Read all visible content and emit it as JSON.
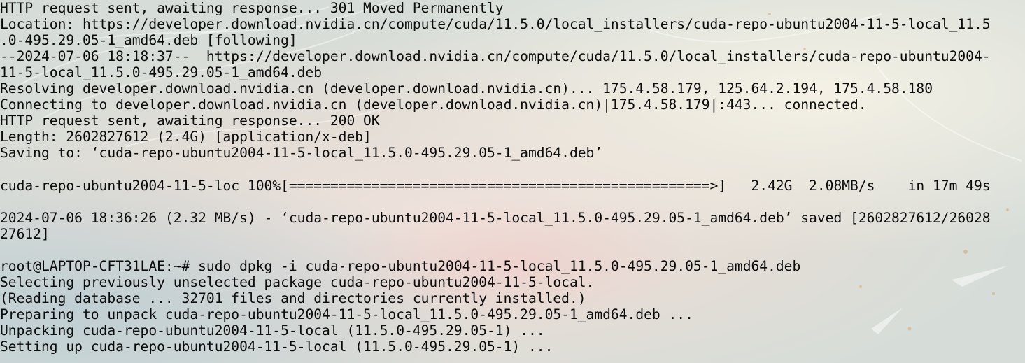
{
  "terminal": {
    "prompt": "root@LAPTOP-CFT31LAE:~# ",
    "command": "sudo dpkg -i cuda-repo-ubuntu2004-11-5-local_11.5.0-495.29.05-1_amd64.deb",
    "download_lines": [
      "HTTP request sent, awaiting response... 301 Moved Permanently",
      "Location: https://developer.download.nvidia.cn/compute/cuda/11.5.0/local_installers/cuda-repo-ubuntu2004-11-5-local_11.5",
      ".0-495.29.05-1_amd64.deb [following]",
      "--2024-07-06 18:18:37--  https://developer.download.nvidia.cn/compute/cuda/11.5.0/local_installers/cuda-repo-ubuntu2004-",
      "11-5-local_11.5.0-495.29.05-1_amd64.deb",
      "Resolving developer.download.nvidia.cn (developer.download.nvidia.cn)... 175.4.58.179, 125.64.2.194, 175.4.58.180",
      "Connecting to developer.download.nvidia.cn (developer.download.nvidia.cn)|175.4.58.179|:443... connected.",
      "HTTP request sent, awaiting response... 200 OK",
      "Length: 2602827612 (2.4G) [application/x-deb]",
      "Saving to: ‘cuda-repo-ubuntu2004-11-5-local_11.5.0-495.29.05-1_amd64.deb’"
    ],
    "progress_line": "cuda-repo-ubuntu2004-11-5-loc 100%[===================================================>]   2.42G  2.08MB/s    in 17m 49s",
    "progress_percent": 100,
    "saved_lines": [
      "2024-07-06 18:36:26 (2.32 MB/s) - ‘cuda-repo-ubuntu2004-11-5-local_11.5.0-495.29.05-1_amd64.deb’ saved [2602827612/26028",
      "27612]"
    ],
    "output_lines": [
      "Selecting previously unselected package cuda-repo-ubuntu2004-11-5-local.",
      "(Reading database ... 32701 files and directories currently installed.)",
      "Preparing to unpack cuda-repo-ubuntu2004-11-5-local_11.5.0-495.29.05-1_amd64.deb ...",
      "Unpacking cuda-repo-ubuntu2004-11-5-local (11.5.0-495.29.05-1) ...",
      "Setting up cuda-repo-ubuntu2004-11-5-local (11.5.0-495.29.05-1) ..."
    ],
    "colors": {
      "text": "#0c0c0c",
      "background": "#dfe2df"
    }
  }
}
